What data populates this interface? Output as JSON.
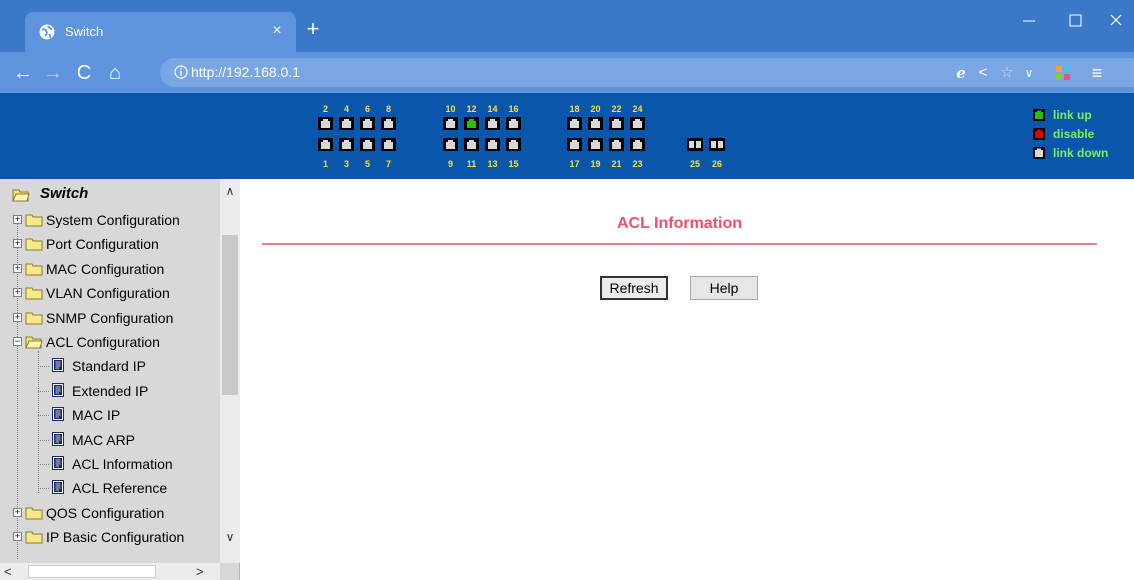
{
  "browser": {
    "tab_title": "Switch",
    "new_tab": "+",
    "close_tab": "×",
    "url_scheme": "http://",
    "url_host": "192.168.0.1",
    "window_controls": {
      "minimize": "—",
      "maximize": "☐",
      "close": "✕"
    },
    "nav": {
      "back": "←",
      "forward": "→",
      "reload": "C",
      "home": "⌂"
    },
    "toolbar_icons": [
      "ie-mode-icon",
      "share-icon",
      "favorite-star-icon",
      "dropdown-icon",
      "extensions-grid-icon",
      "menu-icon"
    ]
  },
  "ports": {
    "top_numbers": [
      "2",
      "4",
      "6",
      "8",
      "10",
      "12",
      "14",
      "16",
      "18",
      "20",
      "22",
      "24"
    ],
    "bottom_numbers": [
      "1",
      "3",
      "5",
      "7",
      "9",
      "11",
      "13",
      "15",
      "17",
      "19",
      "21",
      "23"
    ],
    "uplink_numbers": [
      "25",
      "26"
    ],
    "link_up_port": "12",
    "colors": {
      "link_up": "#22c400",
      "disable": "#e00000",
      "link_down": "#d8d8d8"
    }
  },
  "legend": [
    {
      "label": "link up",
      "color": "#22c400"
    },
    {
      "label": "disable",
      "color": "#e00000"
    },
    {
      "label": "link down",
      "color": "#d8d8d8"
    }
  ],
  "sidebar": {
    "root": "Switch",
    "items": [
      {
        "label": "System Configuration",
        "type": "folder",
        "expanded": false
      },
      {
        "label": "Port Configuration",
        "type": "folder",
        "expanded": false
      },
      {
        "label": "MAC Configuration",
        "type": "folder",
        "expanded": false
      },
      {
        "label": "VLAN Configuration",
        "type": "folder",
        "expanded": false
      },
      {
        "label": "SNMP Configuration",
        "type": "folder",
        "expanded": false
      },
      {
        "label": "ACL Configuration",
        "type": "folder",
        "expanded": true
      },
      {
        "label": "Standard IP",
        "type": "page"
      },
      {
        "label": "Extended IP",
        "type": "page"
      },
      {
        "label": "MAC IP",
        "type": "page"
      },
      {
        "label": "MAC ARP",
        "type": "page"
      },
      {
        "label": "ACL Information",
        "type": "page"
      },
      {
        "label": "ACL Reference",
        "type": "page"
      },
      {
        "label": "QOS Configuration",
        "type": "folder",
        "expanded": false
      },
      {
        "label": "IP Basic Configuration",
        "type": "folder",
        "expanded": false
      }
    ]
  },
  "main": {
    "title": "ACL Information",
    "refresh_label": "Refresh",
    "help_label": "Help"
  }
}
